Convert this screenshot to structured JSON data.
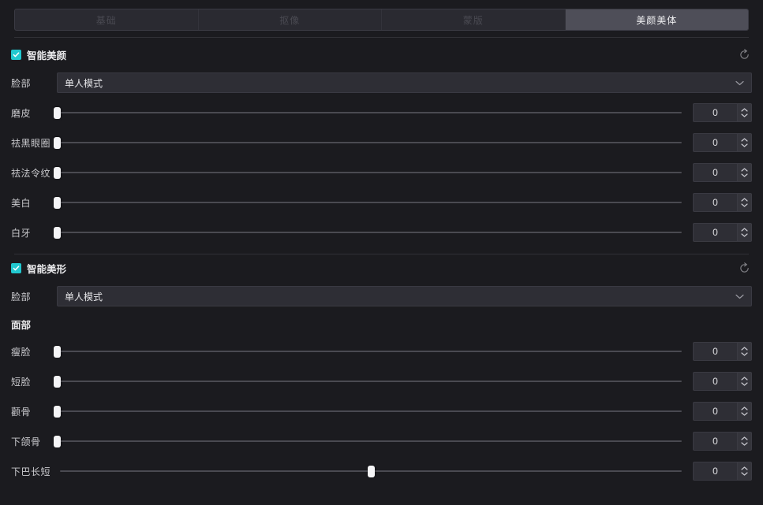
{
  "tabs": [
    {
      "label": "基础",
      "active": false
    },
    {
      "label": "抠像",
      "active": false
    },
    {
      "label": "蒙版",
      "active": false
    },
    {
      "label": "美颜美体",
      "active": true
    }
  ],
  "sections": [
    {
      "id": "smart-beauty",
      "title": "智能美颜",
      "checked": true,
      "reset_icon": "reset-icon",
      "select": {
        "label": "脸部",
        "value": "单人模式",
        "icon": "chevron-down-icon"
      },
      "sliders": [
        {
          "label": "磨皮",
          "value": "0",
          "percent": 0,
          "bipolar": false
        },
        {
          "label": "祛黑眼圈",
          "value": "0",
          "percent": 0,
          "bipolar": false
        },
        {
          "label": "祛法令纹",
          "value": "0",
          "percent": 0,
          "bipolar": false
        },
        {
          "label": "美白",
          "value": "0",
          "percent": 0,
          "bipolar": false
        },
        {
          "label": "白牙",
          "value": "0",
          "percent": 0,
          "bipolar": false
        }
      ]
    },
    {
      "id": "smart-shape",
      "title": "智能美形",
      "checked": true,
      "reset_icon": "reset-icon",
      "select": {
        "label": "脸部",
        "value": "单人模式",
        "icon": "chevron-down-icon"
      },
      "subheading": "面部",
      "sliders": [
        {
          "label": "瘦脸",
          "value": "0",
          "percent": 0,
          "bipolar": false
        },
        {
          "label": "短脸",
          "value": "0",
          "percent": 0,
          "bipolar": false
        },
        {
          "label": "颧骨",
          "value": "0",
          "percent": 0,
          "bipolar": false
        },
        {
          "label": "下颌骨",
          "value": "0",
          "percent": 0,
          "bipolar": false
        },
        {
          "label": "下巴长短",
          "value": "0",
          "percent": 50,
          "bipolar": true
        }
      ]
    }
  ],
  "colors": {
    "background": "#1b1b1f",
    "accent": "#22c8cf",
    "tab_active_bg": "#4e4e58",
    "field_bg": "#2e2e35",
    "thumb": "#f5f5f7",
    "track": "#4a4a51"
  }
}
